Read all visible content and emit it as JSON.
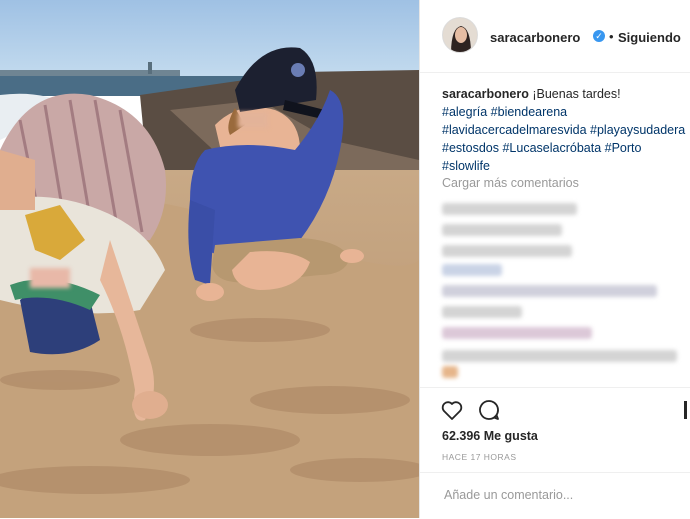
{
  "post": {
    "username": "saracarbonero",
    "follow_separator": "•",
    "follow_status": "Siguiendo",
    "caption": {
      "username": "saracarbonero",
      "text": "¡Buenas tardes!",
      "hashtags": [
        "#alegría",
        "#biendearena",
        "#lavidacercadelmaresvida",
        "#playaysudadera",
        "#estosdos",
        "#Lucaselacróbata",
        "#Porto",
        "#slowlife"
      ]
    },
    "load_more_label": "Cargar más comentarios",
    "likes_label": "62.396 Me gusta",
    "timestamp": "HACE 17 HORAS",
    "comment_placeholder": "Añade un comentario..."
  },
  "icons": {
    "verified": "verified-badge-icon",
    "like": "heart-icon",
    "comment": "comment-bubble-icon",
    "save": "bookmark-icon"
  },
  "colors": {
    "verified_blue": "#3897f0",
    "hashtag": "#003569",
    "muted": "#999999"
  }
}
